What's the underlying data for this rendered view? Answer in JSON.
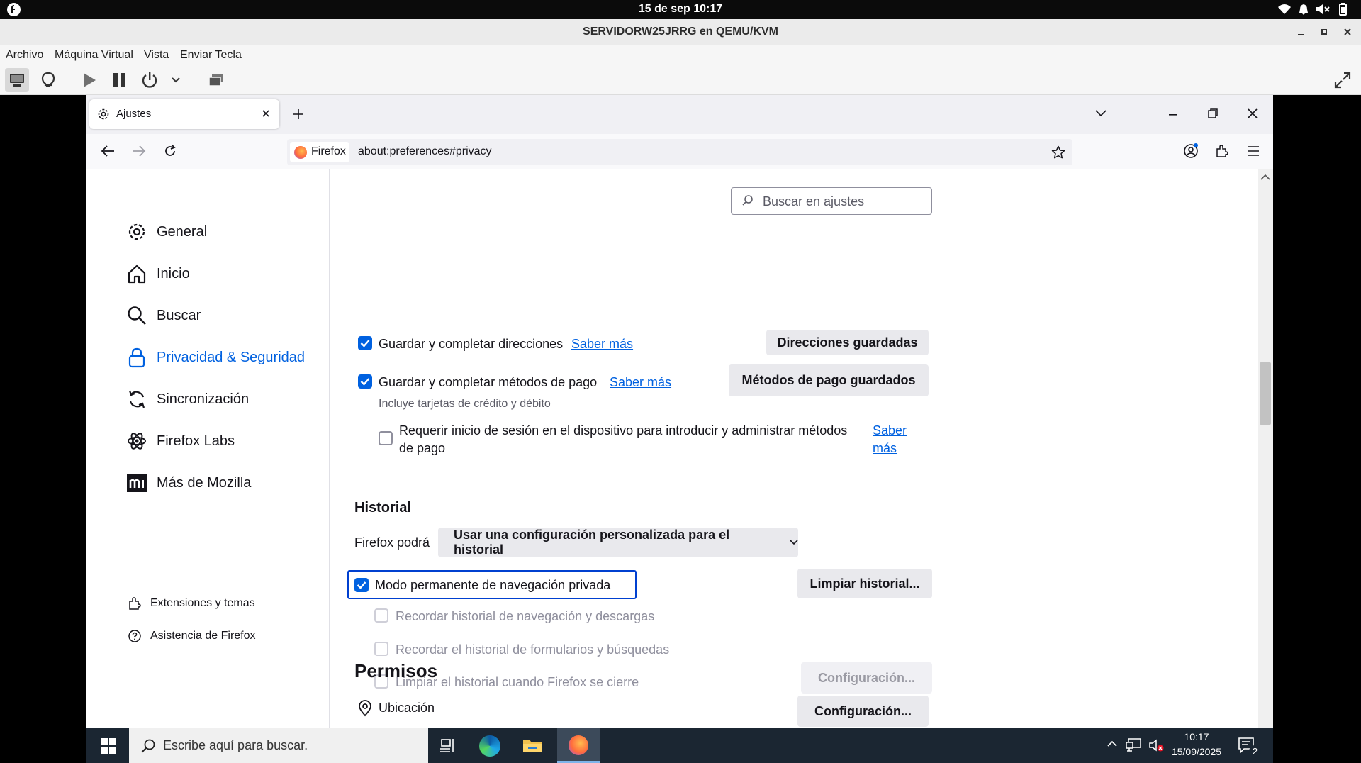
{
  "gnome": {
    "clock": "15 de sep  10:17"
  },
  "vm": {
    "title": "SERVIDORW25JRRG en QEMU/KVM",
    "menu": [
      "Archivo",
      "Máquina Virtual",
      "Vista",
      "Enviar Tecla"
    ]
  },
  "browser": {
    "tab_title": "Ajustes",
    "identity_label": "Firefox",
    "url": "about:preferences#privacy"
  },
  "sidebar": {
    "categories": [
      {
        "label": "General",
        "icon": "gear-icon"
      },
      {
        "label": "Inicio",
        "icon": "home-icon"
      },
      {
        "label": "Buscar",
        "icon": "search-icon"
      },
      {
        "label": "Privacidad & Seguridad",
        "icon": "lock-icon",
        "selected": true
      },
      {
        "label": "Sincronización",
        "icon": "sync-icon"
      },
      {
        "label": "Firefox Labs",
        "icon": "labs-icon"
      },
      {
        "label": "Más de Mozilla",
        "icon": "mozilla-icon"
      }
    ],
    "footer": [
      "Extensiones y temas",
      "Asistencia de Firefox"
    ]
  },
  "search": {
    "placeholder": "Buscar en ajustes"
  },
  "autofill": {
    "addresses_label": "Guardar y completar direcciones",
    "addresses_checked": true,
    "learn_more": "Saber más",
    "saved_addresses_button": "Direcciones guardadas",
    "payments_label": "Guardar y completar métodos de pago",
    "payments_checked": true,
    "saved_payments_button": "Métodos de pago guardados",
    "payments_note": "Incluye tarjetas de crédito y débito",
    "require_login_line1": "Requerir inicio de sesión en el dispositivo para introducir y administrar métodos",
    "require_login_line2": "de pago",
    "require_login_checked": false,
    "learn_more_line1": "Saber",
    "learn_more_line2": "más"
  },
  "history": {
    "heading": "Historial",
    "will_label": "Firefox podrá",
    "mode_select": "Usar una configuración personalizada para el historial",
    "private_mode_label": "Modo permanente de navegación privada",
    "private_mode_checked": true,
    "clear_button": "Limpiar historial...",
    "remember_browsing": "Recordar historial de navegación y descargas",
    "remember_forms": "Recordar el historial de formularios y búsquedas",
    "clear_on_close": "Limpiar el historial cuando Firefox se cierre",
    "settings_button": "Configuración..."
  },
  "permissions": {
    "heading": "Permisos",
    "location_label": "Ubicación",
    "location_button": "Configuración..."
  },
  "taskbar": {
    "search_placeholder": "Escribe aquí para buscar.",
    "time": "10:17",
    "date": "15/09/2025",
    "notifications": "2"
  },
  "colors": {
    "accent": "#0061e0",
    "focus_ring": "#0040d0"
  }
}
